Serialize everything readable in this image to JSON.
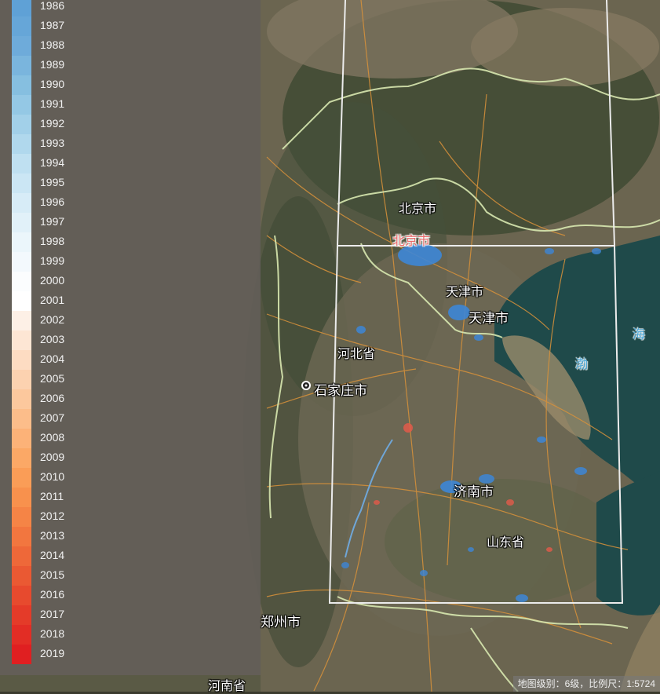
{
  "legend": {
    "items": [
      {
        "year": "1986",
        "color": "#5fa1d6"
      },
      {
        "year": "1987",
        "color": "#66a6d8"
      },
      {
        "year": "1988",
        "color": "#6eabda"
      },
      {
        "year": "1989",
        "color": "#7ab5dd"
      },
      {
        "year": "1990",
        "color": "#86bfe0"
      },
      {
        "year": "1991",
        "color": "#94c8e5"
      },
      {
        "year": "1992",
        "color": "#a2d0e9"
      },
      {
        "year": "1993",
        "color": "#b0d8ed"
      },
      {
        "year": "1994",
        "color": "#bfe0f1"
      },
      {
        "year": "1995",
        "color": "#cbe6f4"
      },
      {
        "year": "1996",
        "color": "#d7ecf7"
      },
      {
        "year": "1997",
        "color": "#e1f1f9"
      },
      {
        "year": "1998",
        "color": "#ebf6fb"
      },
      {
        "year": "1999",
        "color": "#f3f9fd"
      },
      {
        "year": "2000",
        "color": "#fbfdfe"
      },
      {
        "year": "2001",
        "color": "#ffffff"
      },
      {
        "year": "2002",
        "color": "#fdf0e6"
      },
      {
        "year": "2003",
        "color": "#fde6d4"
      },
      {
        "year": "2004",
        "color": "#fddcc2"
      },
      {
        "year": "2005",
        "color": "#fcd2b0"
      },
      {
        "year": "2006",
        "color": "#fcc89d"
      },
      {
        "year": "2007",
        "color": "#fcbd8a"
      },
      {
        "year": "2008",
        "color": "#fcb278"
      },
      {
        "year": "2009",
        "color": "#fba866"
      },
      {
        "year": "2010",
        "color": "#fa9d57"
      },
      {
        "year": "2011",
        "color": "#f8914d"
      },
      {
        "year": "2012",
        "color": "#f58446"
      },
      {
        "year": "2013",
        "color": "#f2763f"
      },
      {
        "year": "2014",
        "color": "#ee6839"
      },
      {
        "year": "2015",
        "color": "#ea5933"
      },
      {
        "year": "2016",
        "color": "#e74a2e"
      },
      {
        "year": "2017",
        "color": "#e43b29"
      },
      {
        "year": "2018",
        "color": "#e22d25"
      },
      {
        "year": "2019",
        "color": "#e01f21"
      }
    ]
  },
  "map": {
    "labels": {
      "beijing": "北京市",
      "beijing_red": "北京市",
      "tianjin_1": "天津市",
      "tianjin_2": "天津市",
      "hebei": "河北省",
      "shijiazhuang": "石家庄市",
      "jinan": "济南市",
      "shandong": "山东省",
      "zhengzhou": "郑州市",
      "henan": "河南省",
      "sea_1": "海",
      "sea_2": "渤"
    }
  },
  "status": {
    "text": "地图级别：6级，比例尺：1:5724"
  }
}
